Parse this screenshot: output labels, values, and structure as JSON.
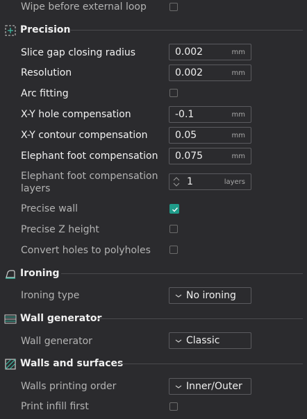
{
  "rows": {
    "wipe_before_loop": {
      "label": "Wipe before external loop",
      "checked": false
    },
    "slice_gap": {
      "label": "Slice gap closing radius",
      "value": "0.002",
      "unit": "mm"
    },
    "resolution": {
      "label": "Resolution",
      "value": "0.002",
      "unit": "mm"
    },
    "arc_fitting": {
      "label": "Arc fitting",
      "checked": false
    },
    "xy_hole": {
      "label": "X-Y hole compensation",
      "value": "-0.1",
      "unit": "mm"
    },
    "xy_contour": {
      "label": "X-Y contour compensation",
      "value": "0.05",
      "unit": "mm"
    },
    "elephant_foot": {
      "label": "Elephant foot compensation",
      "value": "0.075",
      "unit": "mm"
    },
    "elephant_layers": {
      "label": "Elephant foot compensation layers",
      "value": "1",
      "unit": "layers"
    },
    "precise_wall": {
      "label": "Precise wall",
      "checked": true
    },
    "precise_z": {
      "label": "Precise Z height",
      "checked": false
    },
    "convert_holes": {
      "label": "Convert holes to polyholes",
      "checked": false
    },
    "ironing_type": {
      "label": "Ironing type",
      "value": "No ironing"
    },
    "wall_generator": {
      "label": "Wall generator",
      "value": "Classic"
    },
    "walls_order": {
      "label": "Walls printing order",
      "value": "Inner/Outer"
    },
    "infill_first": {
      "label": "Print infill first",
      "checked": false
    }
  },
  "sections": {
    "precision": {
      "title": "Precision",
      "icon": "precision-icon"
    },
    "ironing": {
      "title": "Ironing",
      "icon": "ironing-icon"
    },
    "wall_generator": {
      "title": "Wall generator",
      "icon": "wall-generator-icon"
    },
    "walls_surfaces": {
      "title": "Walls and surfaces",
      "icon": "walls-surfaces-icon"
    }
  },
  "colors": {
    "accent": "#1f9c8a",
    "background": "#2b2b2e"
  }
}
